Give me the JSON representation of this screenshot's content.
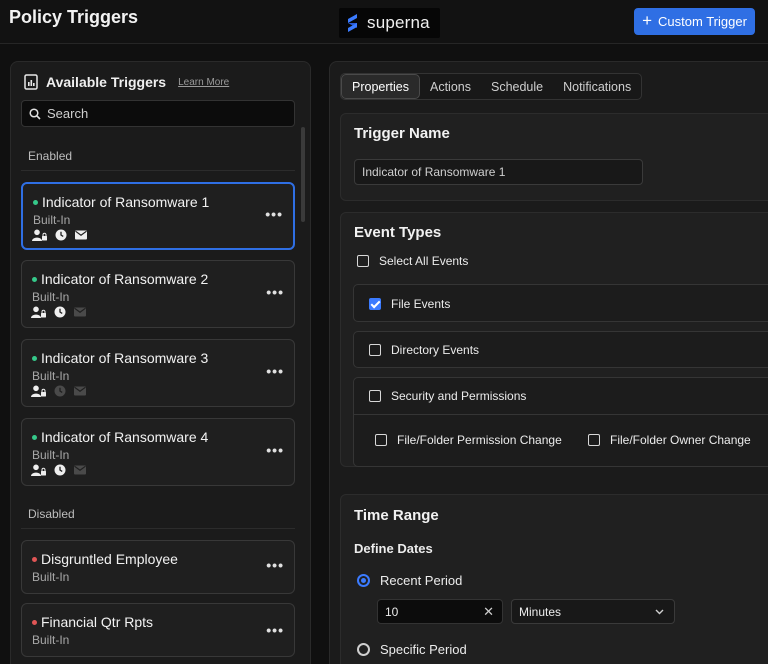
{
  "header": {
    "title": "Policy Triggers",
    "logo_text": "superna",
    "custom_trigger_label": "Custom Trigger"
  },
  "sidebar": {
    "title": "Available Triggers",
    "learn_more": "Learn More",
    "search_placeholder": "Search",
    "enabled_label": "Enabled",
    "disabled_label": "Disabled",
    "enabled_triggers": [
      {
        "name": "Indicator of Ransomware 1",
        "type": "Built-In",
        "status": "enabled",
        "icons": {
          "user": true,
          "clock": true,
          "mail": true
        }
      },
      {
        "name": "Indicator of Ransomware 2",
        "type": "Built-In",
        "status": "enabled",
        "icons": {
          "user": true,
          "clock": true,
          "mail": false
        }
      },
      {
        "name": "Indicator of Ransomware 3",
        "type": "Built-In",
        "status": "enabled",
        "icons": {
          "user": true,
          "clock": false,
          "mail": false
        }
      },
      {
        "name": "Indicator of Ransomware 4",
        "type": "Built-In",
        "status": "enabled",
        "icons": {
          "user": true,
          "clock": true,
          "mail": false
        }
      }
    ],
    "disabled_triggers": [
      {
        "name": "Disgruntled Employee",
        "type": "Built-In",
        "status": "disabled"
      },
      {
        "name": "Financial Qtr Rpts",
        "type": "Built-In",
        "status": "disabled"
      }
    ]
  },
  "tabs": [
    "Properties",
    "Actions",
    "Schedule",
    "Notifications"
  ],
  "trigger_name": {
    "title": "Trigger Name",
    "value": "Indicator of Ransomware 1"
  },
  "event_types": {
    "title": "Event Types",
    "select_all": "Select All Events",
    "file_events": "File Events",
    "directory_events": "Directory Events",
    "security_permissions": "Security and Permissions",
    "perm_change": "File/Folder Permission Change",
    "owner_change": "File/Folder Owner Change"
  },
  "time_range": {
    "title": "Time Range",
    "define_dates": "Define Dates",
    "recent_period": "Recent Period",
    "period_value": "10",
    "period_unit": "Minutes",
    "specific_period": "Specific Period"
  },
  "colors": {
    "accent": "#2f6fe4",
    "enabled_dot": "#35c98a",
    "disabled_dot": "#e05555"
  }
}
